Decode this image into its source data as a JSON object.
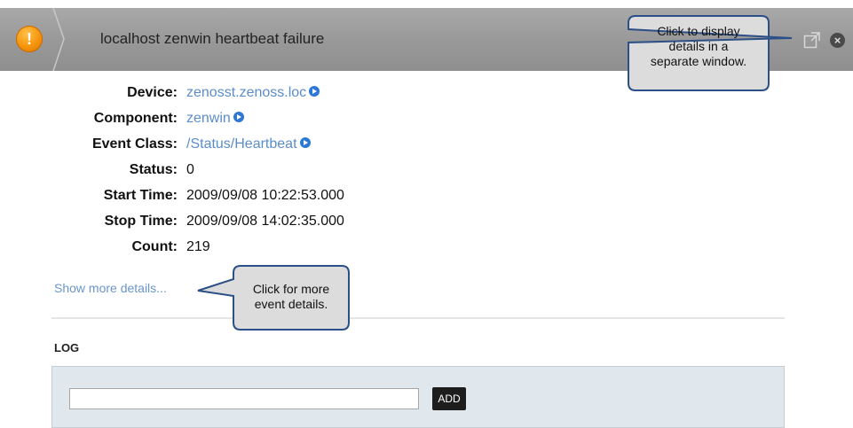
{
  "header": {
    "severity_symbol": "!",
    "title": "localhost zenwin heartbeat failure",
    "colors": {
      "severity": "#f5930b",
      "bar": "#999999"
    },
    "icons": [
      "severity-warning-icon",
      "popout-window-icon",
      "close-icon"
    ]
  },
  "details": {
    "device": {
      "label": "Device:",
      "value": "zenosst.zenoss.loc"
    },
    "component": {
      "label": "Component:",
      "value": "zenwin"
    },
    "event_class": {
      "label": "Event Class:",
      "value": "/Status/Heartbeat"
    },
    "status": {
      "label": "Status:",
      "value": "0"
    },
    "start_time": {
      "label": "Start Time:",
      "value": "2009/09/08 10:22:53.000"
    },
    "stop_time": {
      "label": "Stop Time:",
      "value": "2009/09/08 14:02:35.000"
    },
    "count": {
      "label": "Count:",
      "value": "219"
    },
    "link_color": "#5b8dc9"
  },
  "more_details_link": "Show more details...",
  "log": {
    "heading": "LOG",
    "input_value": "",
    "add_label": "ADD"
  },
  "callouts": {
    "window_line1": "Click to display",
    "window_line2": "details in a",
    "window_line3": "separate window.",
    "more_line1": "Click for more",
    "more_line2": "event details."
  }
}
